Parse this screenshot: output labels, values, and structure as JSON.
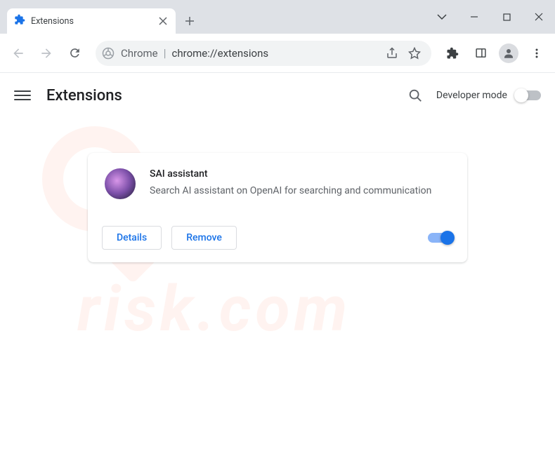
{
  "tab": {
    "title": "Extensions"
  },
  "omnibox": {
    "label": "Chrome",
    "url": "chrome://extensions"
  },
  "header": {
    "title": "Extensions",
    "dev_mode_label": "Developer mode",
    "dev_mode_on": false
  },
  "extension": {
    "name": "SAI assistant",
    "description": "Search AI assistant on OpenAI for searching and communication",
    "details_label": "Details",
    "remove_label": "Remove",
    "enabled": true
  }
}
